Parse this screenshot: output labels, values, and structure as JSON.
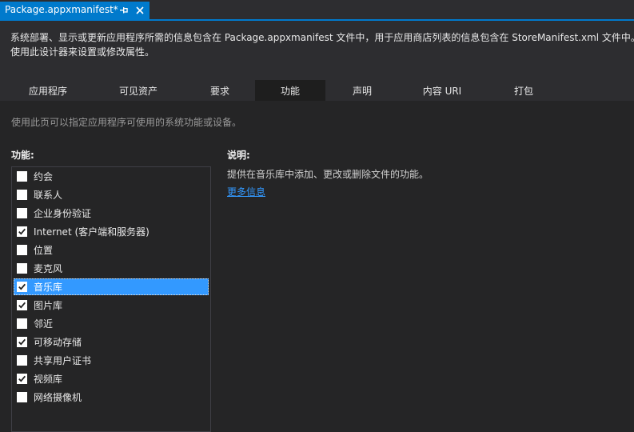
{
  "doc_tab": {
    "title": "Package.appxmanifest*"
  },
  "header": {
    "description": "系统部署、显示或更新应用程序所需的信息包含在 Package.appxmanifest 文件中，用于应用商店列表的信息包含在 StoreManifest.xml 文件中。请使用此设计器来设置或修改属性。"
  },
  "tabs": [
    {
      "label": "应用程序",
      "active": false
    },
    {
      "label": "可见资产",
      "active": false
    },
    {
      "label": "要求",
      "active": false
    },
    {
      "label": "功能",
      "active": true
    },
    {
      "label": "声明",
      "active": false
    },
    {
      "label": "内容 URI",
      "active": false
    },
    {
      "label": "打包",
      "active": false
    }
  ],
  "content": {
    "hint": "使用此页可以指定应用程序可使用的系统功能或设备。",
    "capabilities_label": "功能:",
    "capabilities": [
      {
        "label": "约会",
        "checked": false,
        "selected": false
      },
      {
        "label": "联系人",
        "checked": false,
        "selected": false
      },
      {
        "label": "企业身份验证",
        "checked": false,
        "selected": false
      },
      {
        "label": "Internet (客户端和服务器)",
        "checked": true,
        "selected": false
      },
      {
        "label": "位置",
        "checked": false,
        "selected": false
      },
      {
        "label": "麦克风",
        "checked": false,
        "selected": false
      },
      {
        "label": "音乐库",
        "checked": true,
        "selected": true
      },
      {
        "label": "图片库",
        "checked": true,
        "selected": false
      },
      {
        "label": "邻近",
        "checked": false,
        "selected": false
      },
      {
        "label": "可移动存储",
        "checked": true,
        "selected": false
      },
      {
        "label": "共享用户证书",
        "checked": false,
        "selected": false
      },
      {
        "label": "视频库",
        "checked": true,
        "selected": false
      },
      {
        "label": "网络摄像机",
        "checked": false,
        "selected": false
      }
    ],
    "description_label": "说明:",
    "description_text": "提供在音乐库中添加、更改或删除文件的功能。",
    "more_info_link": "更多信息"
  },
  "colors": {
    "accent": "#007acc",
    "selected": "#3399ff",
    "link": "#3399ff"
  }
}
